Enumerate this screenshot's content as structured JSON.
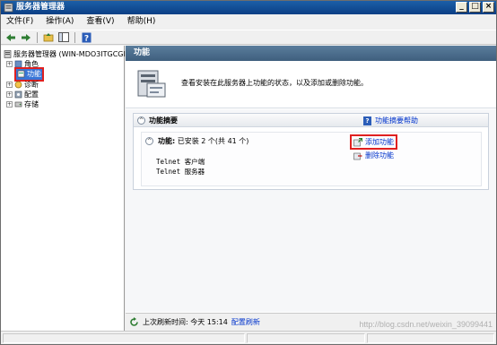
{
  "window": {
    "title": "服务器管理器",
    "minimize": "_",
    "maximize": "□",
    "close": "×"
  },
  "menu": [
    "文件(F)",
    "操作(A)",
    "查看(V)",
    "帮助(H)"
  ],
  "tree": {
    "root": "服务器管理器 (WIN-MDO3ITGCGI",
    "items": [
      {
        "label": "角色",
        "expander": "+"
      },
      {
        "label": "功能",
        "expander": ""
      },
      {
        "label": "诊断",
        "expander": "+"
      },
      {
        "label": "配置",
        "expander": "+"
      },
      {
        "label": "存储",
        "expander": "+"
      }
    ]
  },
  "right": {
    "header": "功能",
    "description": "查看安装在此服务器上功能的状态，以及添加或删除功能。",
    "summary_title": "功能摘要",
    "summary_help": "功能摘要帮助",
    "features_label": "功能:",
    "features_status": "已安装 2 个(共 41 个)",
    "installed": [
      "Telnet 客户端",
      "Telnet 服务器"
    ],
    "add_features": "添加功能",
    "remove_features": "删除功能",
    "last_refresh_label": "上次刷新时间: 今天 15:14",
    "configure_refresh": "配置刷新"
  },
  "watermark": "http://blog.csdn.net/weixin_39099441",
  "colors": {
    "title_bar": "#0b3f85",
    "header_bar": "#3f5f7e",
    "link": "#0033cc",
    "highlight_border": "#e02020"
  }
}
